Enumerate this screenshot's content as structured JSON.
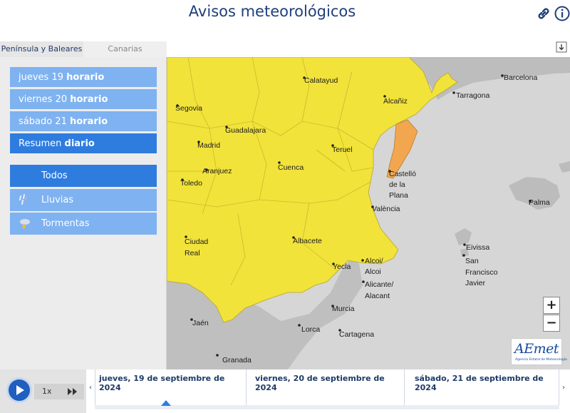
{
  "header": {
    "title": "Avisos meteorológicos"
  },
  "tabs": [
    {
      "label": "Península y Baleares"
    },
    {
      "label": "Canarias"
    }
  ],
  "days": [
    {
      "day": "jueves 19",
      "mode": "horario"
    },
    {
      "day": "viernes 20",
      "mode": "horario"
    },
    {
      "day": "sábado 21",
      "mode": "horario"
    },
    {
      "day": "Resumen",
      "mode": "diario"
    }
  ],
  "filters": [
    {
      "label": "Todos"
    },
    {
      "label": "Lluvias"
    },
    {
      "label": "Tormentas"
    }
  ],
  "map": {
    "cities": [
      "Barcelona",
      "Calatayud",
      "Tarragona",
      "Alcañiz",
      "Segovia",
      "Guadalajara",
      "Teruel",
      "Madrid",
      "Cuenca",
      "Aranjuez",
      "Castelló",
      "de la",
      "Plana",
      "Toledo",
      "Palma",
      "València",
      "Ciudad",
      "Real",
      "Albacete",
      "Eivissa",
      "San",
      "Francisco",
      "Javier",
      "Alcoi/",
      "Alcoi",
      "Yecla",
      "Alicante/",
      "Alacant",
      "Murcia",
      "Jaén",
      "Lorca",
      "Cartagena",
      "Granada"
    ],
    "zoom_in": "+",
    "zoom_out": "−",
    "colors": {
      "yellow": "#f2e33b",
      "orange": "#f2a650",
      "sea": "#d9d9d9",
      "land": "#b8b8b8"
    }
  },
  "logo": {
    "text": "AEmet",
    "subtitle": "Agencia Estatal de Meteorología"
  },
  "timeline": {
    "speed": "1x",
    "days": [
      "jueves, 19 de septiembre de 2024",
      "viernes, 20 de septiembre de 2024",
      "sábado, 21 de septiembre de 2024"
    ]
  },
  "colors": {
    "accent": "#2f7cdf",
    "light": "#7fb2f0",
    "title": "#1f3f7a"
  }
}
